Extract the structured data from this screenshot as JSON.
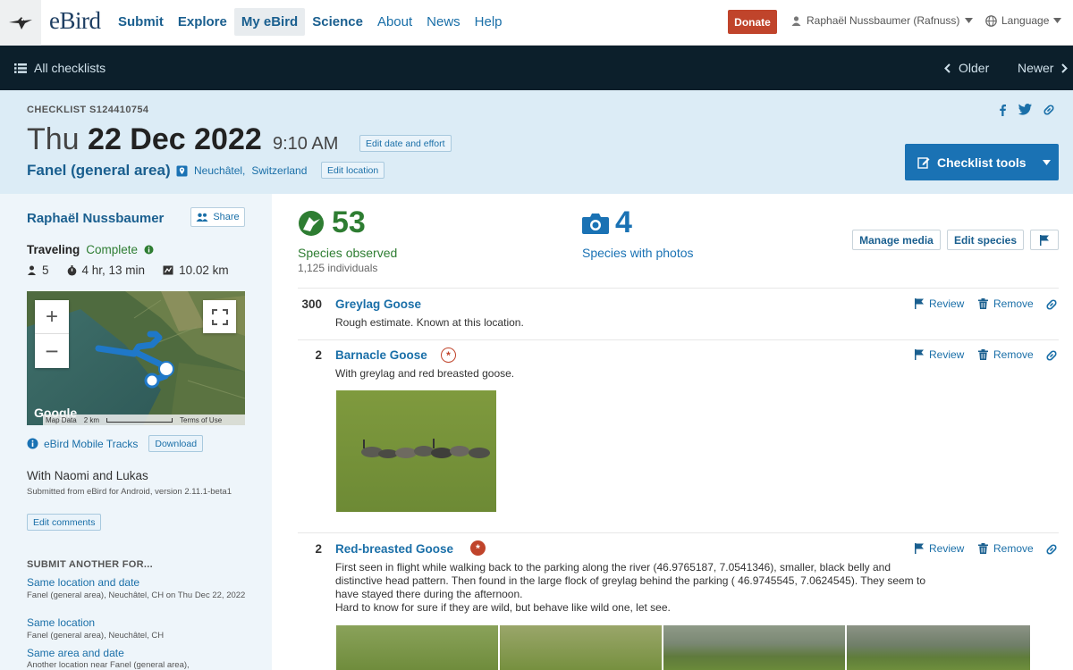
{
  "nav": {
    "logo": "eBird",
    "links": [
      {
        "label": "Submit",
        "bold": true
      },
      {
        "label": "Explore",
        "bold": true
      },
      {
        "label": "My eBird",
        "bold": true,
        "active": true
      },
      {
        "label": "Science",
        "bold": true
      },
      {
        "label": "About",
        "bold": false
      },
      {
        "label": "News",
        "bold": false
      },
      {
        "label": "Help",
        "bold": false
      }
    ],
    "donate": "Donate",
    "user": "Raphaël Nussbaumer (Rafnuss)",
    "language": "Language"
  },
  "subnav": {
    "all_checklists": "All checklists",
    "older": "Older",
    "newer": "Newer"
  },
  "header": {
    "checklist_id": "CHECKLIST S124410754",
    "weekday": "Thu",
    "date": "22 Dec 2022",
    "time": "9:10 AM",
    "edit_date": "Edit date and effort",
    "location": "Fanel (general area)",
    "region": "Neuchâtel,",
    "country": "Switzerland",
    "edit_location": "Edit location",
    "checklist_tools": "Checklist tools"
  },
  "sidebar": {
    "observer": "Raphaël Nussbaumer",
    "share": "Share",
    "protocol": "Traveling",
    "status": "Complete",
    "observers": "5",
    "duration": "4 hr, 13 min",
    "distance": "10.02 km",
    "map": {
      "google": "Google",
      "map_data": "Map Data",
      "scale": "2 km",
      "terms": "Terms of Use"
    },
    "tracks": "eBird Mobile Tracks",
    "download": "Download",
    "comment": "With Naomi and Lukas",
    "submitted": "Submitted from eBird for Android, version 2.11.1-beta1",
    "edit_comments": "Edit comments",
    "submit_another": "SUBMIT ANOTHER FOR...",
    "links": [
      {
        "label": "Same location and date",
        "sub": "Fanel (general area), Neuchâtel, CH on Thu Dec 22, 2022"
      },
      {
        "label": "Same location",
        "sub": "Fanel (general area), Neuchâtel, CH"
      },
      {
        "label": "Same area and date",
        "sub": "Another location near Fanel (general area),"
      }
    ]
  },
  "stats": {
    "species": "53",
    "species_label": "Species observed",
    "individuals": "1,125 individuals",
    "photos": "4",
    "photos_label": "Species with photos",
    "manage_media": "Manage media",
    "edit_species": "Edit species"
  },
  "colors": {
    "species_green": "#2e7d32",
    "photo_blue": "#1a72b4",
    "donate_red": "#c0442b",
    "rare_badge": "#c0442b"
  },
  "observations": [
    {
      "count": "300",
      "name": "Greylag Goose",
      "note": "Rough estimate. Known at this location.",
      "review": "Review",
      "remove": "Remove"
    },
    {
      "count": "2",
      "name": "Barnacle Goose",
      "note": "With greylag and red breasted goose.",
      "review": "Review",
      "remove": "Remove"
    },
    {
      "count": "2",
      "name": "Red-breasted Goose",
      "note": "First seen in flight while walking back to the parking along the river (46.9765187, 7.0541346), smaller, black belly and distinctive head pattern. Then found in the large flock of greylag behind the parking ( 46.9745545, 7.0624545). They seem to have stayed there during the afternoon.",
      "note2": "Hard to know for sure if they are wild, but behave like wild one, let see.",
      "review": "Review",
      "remove": "Remove"
    }
  ]
}
